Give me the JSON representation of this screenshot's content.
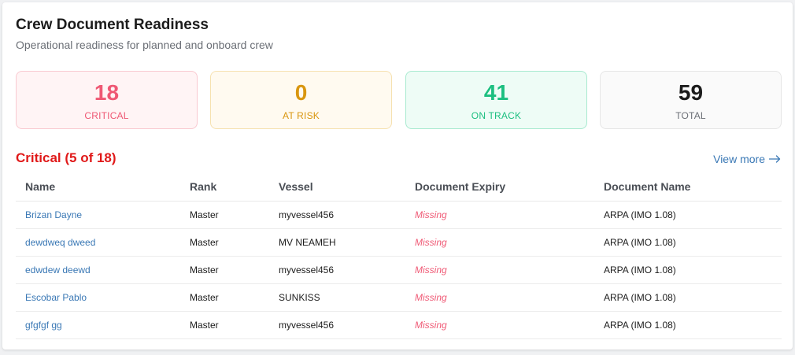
{
  "header": {
    "title": "Crew Document Readiness",
    "subtitle": "Operational readiness for planned and onboard crew"
  },
  "stats": {
    "critical": {
      "value": "18",
      "label": "CRITICAL"
    },
    "at_risk": {
      "value": "0",
      "label": "AT RISK"
    },
    "on_track": {
      "value": "41",
      "label": "ON TRACK"
    },
    "total": {
      "value": "59",
      "label": "TOTAL"
    }
  },
  "section": {
    "title": "Critical (5 of 18)",
    "view_more": "View more"
  },
  "table": {
    "columns": [
      "Name",
      "Rank",
      "Vessel",
      "Document Expiry",
      "Document Name"
    ],
    "rows": [
      {
        "name": "Brizan Dayne",
        "rank": "Master",
        "vessel": "myvessel456",
        "expiry": "Missing",
        "document": "ARPA (IMO 1.08)"
      },
      {
        "name": "dewdweq dweed",
        "rank": "Master",
        "vessel": "MV NEAMEH",
        "expiry": "Missing",
        "document": "ARPA (IMO 1.08)"
      },
      {
        "name": "edwdew deewd",
        "rank": "Master",
        "vessel": "myvessel456",
        "expiry": "Missing",
        "document": "ARPA (IMO 1.08)"
      },
      {
        "name": "Escobar Pablo",
        "rank": "Master",
        "vessel": "SUNKISS",
        "expiry": "Missing",
        "document": "ARPA (IMO 1.08)"
      },
      {
        "name": "gfgfgf gg",
        "rank": "Master",
        "vessel": "myvessel456",
        "expiry": "Missing",
        "document": "ARPA (IMO 1.08)"
      }
    ]
  },
  "colors": {
    "critical": "#ef5874",
    "at_risk": "#d9960f",
    "on_track": "#1cbf80",
    "section_title": "#e01919",
    "link": "#3a78b5"
  },
  "icons": {
    "view_more": "arrow-right-icon"
  }
}
